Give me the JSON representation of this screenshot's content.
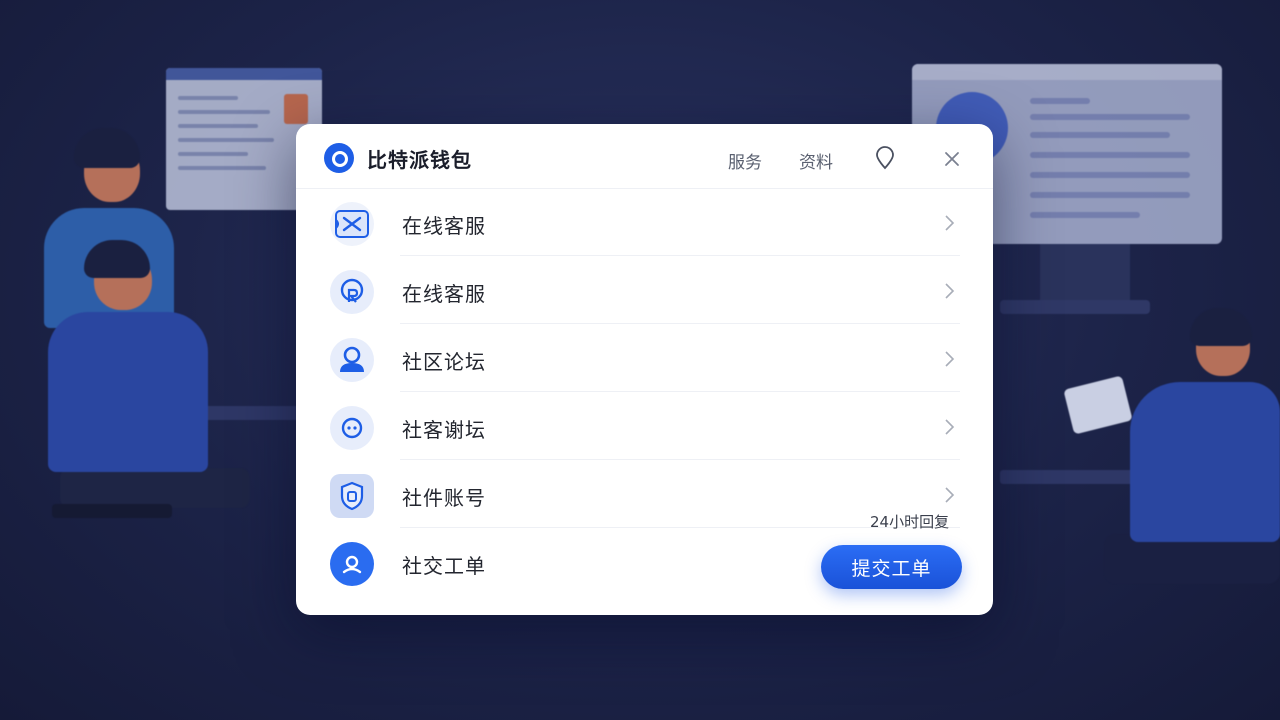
{
  "app": {
    "title": "比特派钱包",
    "brand_color": "#1e5ee6"
  },
  "header": {
    "nav": [
      {
        "label": "服务"
      },
      {
        "label": "资料"
      }
    ],
    "pin_icon": "location-pin-icon",
    "close_icon": "close-icon"
  },
  "list": {
    "items": [
      {
        "label": "在线客服",
        "icon": "ticket-chat-icon"
      },
      {
        "label": "在线客服",
        "icon": "headset-support-icon"
      },
      {
        "label": "社区论坛",
        "icon": "user-profile-icon"
      },
      {
        "label": "社客谢坛",
        "icon": "chat-bubble-icon"
      },
      {
        "label": "社件账号",
        "icon": "shield-account-icon"
      },
      {
        "label": "社交工单",
        "icon": "location-user-icon"
      }
    ]
  },
  "ticket": {
    "note": "24小时回复",
    "submit_label": "提交工单"
  }
}
